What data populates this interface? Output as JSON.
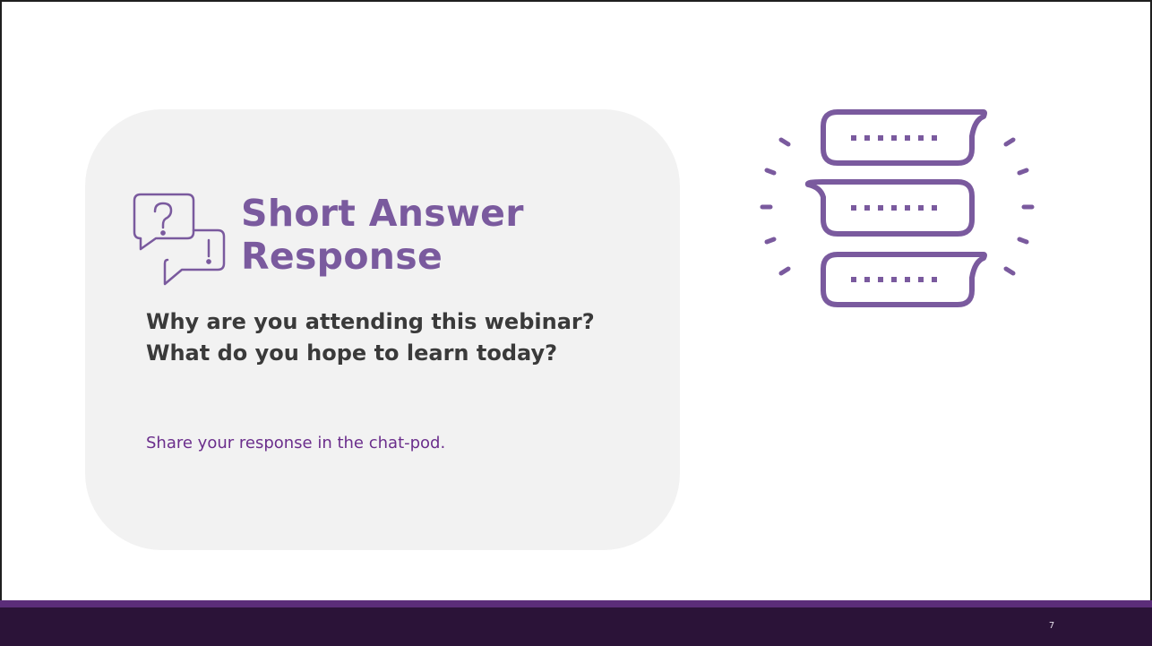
{
  "slide": {
    "title_line1": "Short Answer",
    "title_line2": "Response",
    "question": "Why are you attending this webinar? What do you hope to learn today?",
    "instruction": "Share your response in the chat-pod.",
    "page_number": "7"
  },
  "icons": {
    "qa": "question-answer-speech-bubbles-icon",
    "chat": "chat-messages-icon"
  },
  "colors": {
    "accent_purple": "#7a5a9e",
    "instruction_purple": "#6b2e8c",
    "footer_dark": "#2b1338",
    "footer_accent": "#5b2d79",
    "card_background": "#f2f2f2",
    "question_text": "#3a3a3a"
  }
}
